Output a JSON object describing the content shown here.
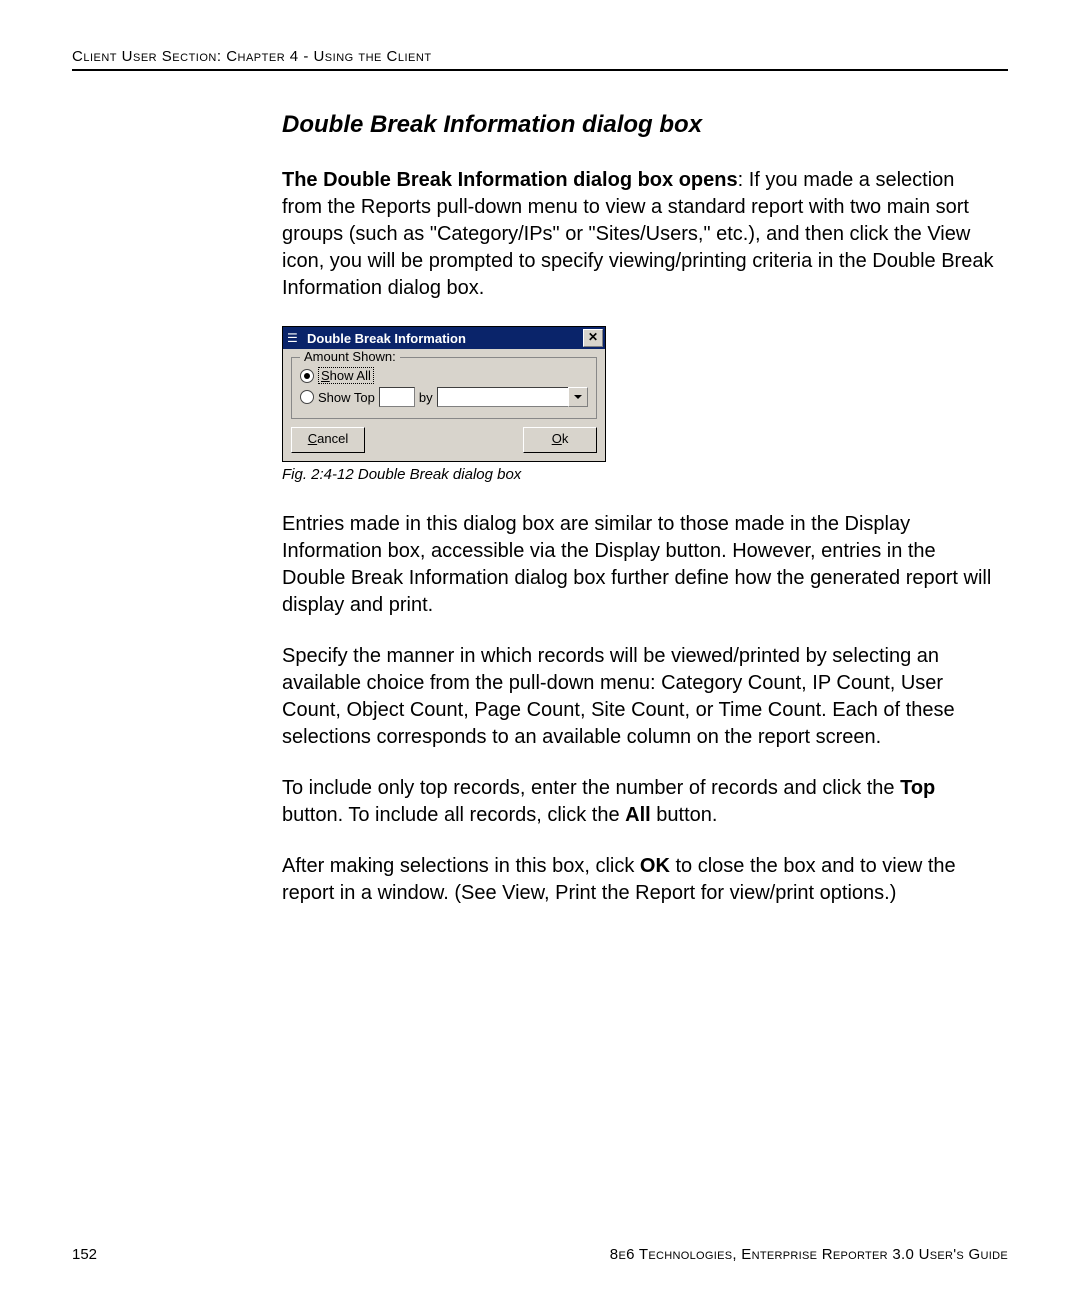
{
  "header": {
    "running_head": "Client User Section: Chapter 4 - Using the Client"
  },
  "section": {
    "title": "Double Break Information dialog box",
    "para1_bold": "The Double Break Information dialog box opens",
    "para1_rest": ": If you made a selection from the Reports pull-down menu to view a standard report with two main sort groups (such as \"Category/IPs\" or \"Sites/Users,\" etc.), and then click the View icon, you will be prompted to specify viewing/printing criteria in the Double Break Information dialog box.",
    "para2": "Entries made in this dialog box are similar to those made in the Display Information box, accessible via the Display button. However, entries in the Double Break Information dialog box further define how the generated report will display and print.",
    "para3": "Specify the manner in which records will be viewed/printed by selecting an available choice from the pull-down menu: Category Count, IP Count, User Count, Object Count, Page Count, Site Count, or Time Count. Each of these selections corresponds to an available column on the report screen.",
    "para4_a": "To include only top records, enter the number of records and click the ",
    "para4_b": "Top",
    "para4_c": " button. To include all records, click the ",
    "para4_d": "All",
    "para4_e": " button.",
    "para5_a": "After making selections in this box, click ",
    "para5_b": "OK",
    "para5_c": " to close the box and to view the report in a window. (See View, Print the Report for view/print options.)"
  },
  "figure": {
    "caption": "Fig. 2:4-12  Double Break dialog box"
  },
  "dialog": {
    "title": "Double Break Information",
    "group_legend": "Amount Shown:",
    "radio_show_all_prefix": "S",
    "radio_show_all_rest": "how All",
    "radio_show_top": "Show Top",
    "by_label": "by",
    "cancel_prefix": "C",
    "cancel_rest": "ancel",
    "ok_prefix": "O",
    "ok_rest": "k"
  },
  "footer": {
    "page_number": "152",
    "right": "8e6 Technologies, Enterprise Reporter 3.0 User's Guide"
  }
}
